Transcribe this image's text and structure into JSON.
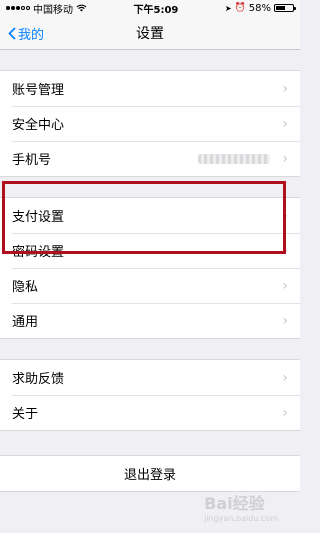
{
  "status_bar": {
    "carrier": "中国移动",
    "time": "下午5:09",
    "battery": "58%",
    "battery_level": 0.58
  },
  "nav": {
    "back_label": "我的",
    "title": "设置"
  },
  "group1": [
    {
      "label": "账号管理"
    },
    {
      "label": "安全中心"
    },
    {
      "label": "手机号"
    }
  ],
  "group2": [
    {
      "label": "支付设置"
    },
    {
      "label": "密码设置"
    },
    {
      "label": "隐私"
    },
    {
      "label": "通用"
    }
  ],
  "group3": [
    {
      "label": "求助反馈"
    },
    {
      "label": "关于"
    }
  ],
  "logout_label": "退出登录",
  "watermark": {
    "text": "Bai经验",
    "sub": "jingyan.baidu.com"
  },
  "colors": {
    "accent": "#0a84ff",
    "highlight": "#b0101e"
  }
}
